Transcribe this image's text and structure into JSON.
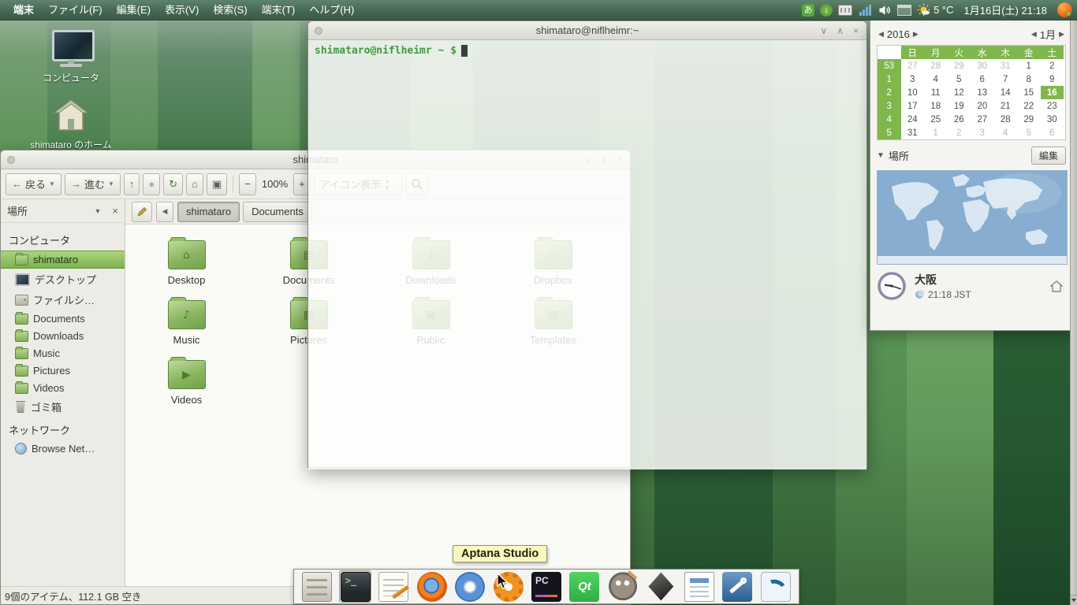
{
  "theme": {
    "panel_green": "#50765f",
    "selection_green": "#84bb52",
    "desktop_green": "#3f7a45",
    "accent_orange": "#ef9422",
    "calendar_green": "#80b74d"
  },
  "panel": {
    "menus": [
      {
        "label": "端末",
        "bold": true
      },
      {
        "label": "ファイル(F)"
      },
      {
        "label": "編集(E)"
      },
      {
        "label": "表示(V)"
      },
      {
        "label": "検索(S)"
      },
      {
        "label": "端末(T)"
      },
      {
        "label": "ヘルプ(H)"
      }
    ],
    "weather_temp": "5 °C",
    "clock": "1月16日(土) 21:18"
  },
  "desktop": {
    "icons": [
      {
        "label": "コンピュータ",
        "kind": "computer"
      },
      {
        "label": "shimataro のホーム",
        "kind": "home"
      }
    ]
  },
  "terminal": {
    "title": "shimataro@niflheimr:~",
    "prompt": {
      "user_host": "shimataro@niflheimr",
      "path": " ~ ",
      "symbol": "$"
    }
  },
  "file_manager": {
    "title": "shimataro",
    "toolbar": {
      "back": "戻る",
      "forward": "進む",
      "zoom_out": "−",
      "zoom_level": "100%",
      "zoom_in": "+",
      "view_mode": "アイコン表示"
    },
    "pathbar": {
      "buttons": [
        "shimataro",
        "Documents"
      ],
      "active": "shimataro"
    },
    "sidebar": {
      "header": "場所",
      "sections": [
        {
          "title": "コンピュータ",
          "items": [
            {
              "label": "shimataro",
              "icon": "folder",
              "selected": true
            },
            {
              "label": "デスクトップ",
              "icon": "desktop"
            },
            {
              "label": "ファイルシ…",
              "icon": "drive"
            },
            {
              "label": "Documents",
              "icon": "folder"
            },
            {
              "label": "Downloads",
              "icon": "folder"
            },
            {
              "label": "Music",
              "icon": "folder"
            },
            {
              "label": "Pictures",
              "icon": "folder"
            },
            {
              "label": "Videos",
              "icon": "folder"
            },
            {
              "label": "ゴミ箱",
              "icon": "trash"
            }
          ]
        },
        {
          "title": "ネットワーク",
          "items": [
            {
              "label": "Browse Net…",
              "icon": "network"
            }
          ]
        }
      ]
    },
    "folders": [
      "Desktop",
      "Documents",
      "Downloads",
      "Dropbox",
      "Music",
      "Pictures",
      "Public",
      "Templates",
      "Videos"
    ],
    "status": "9個のアイテム、112.1 GB 空き"
  },
  "calendar": {
    "year": "2016",
    "month": "1月",
    "day_headers": [
      "日",
      "月",
      "火",
      "水",
      "木",
      "金",
      "土"
    ],
    "weeks": [
      {
        "num": "53",
        "days": [
          {
            "d": "27",
            "dim": true
          },
          {
            "d": "28",
            "dim": true
          },
          {
            "d": "29",
            "dim": true
          },
          {
            "d": "30",
            "dim": true
          },
          {
            "d": "31",
            "dim": true
          },
          {
            "d": "1"
          },
          {
            "d": "2"
          }
        ]
      },
      {
        "num": "1",
        "days": [
          {
            "d": "3"
          },
          {
            "d": "4"
          },
          {
            "d": "5"
          },
          {
            "d": "6"
          },
          {
            "d": "7"
          },
          {
            "d": "8"
          },
          {
            "d": "9"
          }
        ]
      },
      {
        "num": "2",
        "days": [
          {
            "d": "10"
          },
          {
            "d": "11"
          },
          {
            "d": "12"
          },
          {
            "d": "13"
          },
          {
            "d": "14"
          },
          {
            "d": "15"
          },
          {
            "d": "16",
            "selected": true
          }
        ]
      },
      {
        "num": "3",
        "days": [
          {
            "d": "17"
          },
          {
            "d": "18"
          },
          {
            "d": "19"
          },
          {
            "d": "20"
          },
          {
            "d": "21"
          },
          {
            "d": "22"
          },
          {
            "d": "23"
          }
        ]
      },
      {
        "num": "4",
        "days": [
          {
            "d": "24"
          },
          {
            "d": "25"
          },
          {
            "d": "26"
          },
          {
            "d": "27"
          },
          {
            "d": "28"
          },
          {
            "d": "29"
          },
          {
            "d": "30"
          }
        ]
      },
      {
        "num": "5",
        "days": [
          {
            "d": "31"
          },
          {
            "d": "1",
            "dim": true
          },
          {
            "d": "2",
            "dim": true
          },
          {
            "d": "3",
            "dim": true
          },
          {
            "d": "4",
            "dim": true
          },
          {
            "d": "5",
            "dim": true
          },
          {
            "d": "6",
            "dim": true
          }
        ]
      }
    ],
    "locations": {
      "label": "場所",
      "edit_button": "編集",
      "city": "大阪",
      "time": "21:18 JST"
    }
  },
  "dock": {
    "tooltip": "Aptana Studio",
    "items": [
      {
        "name": "archive-manager"
      },
      {
        "name": "terminal",
        "active": true
      },
      {
        "name": "text-editor"
      },
      {
        "name": "firefox"
      },
      {
        "name": "chromium"
      },
      {
        "name": "aptana-studio"
      },
      {
        "name": "phpstorm",
        "label": "PC"
      },
      {
        "name": "qt-creator",
        "label": "Qt"
      },
      {
        "name": "gimp"
      },
      {
        "name": "inkscape"
      },
      {
        "name": "writer"
      },
      {
        "name": "workbench"
      },
      {
        "name": "mysql"
      }
    ]
  }
}
